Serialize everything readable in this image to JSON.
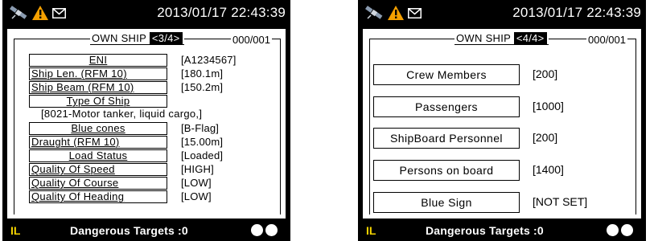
{
  "screens": [
    {
      "datetime": "2013/01/17 22:43:39",
      "title_prefix": "OWN SHIP ",
      "title_page": "<3/4>",
      "counter": "000/001",
      "fields": [
        {
          "label": "ENI",
          "value": "[A1234567]"
        },
        {
          "label": "Ship Len.  (RFM 10)",
          "value": "[180.1m]"
        },
        {
          "label": "Ship Beam (RFM 10)",
          "value": "[150.2m]"
        },
        {
          "label": "Type Of Ship",
          "value": ""
        },
        {
          "label": "",
          "value": "[8021-Motor tanker, liquid cargo,]"
        },
        {
          "label": "Blue  cones",
          "value": "[B-Flag]"
        },
        {
          "label": "Draught (RFM 10)",
          "value": "[15.00m]"
        },
        {
          "label": "Load Status",
          "value": "[Loaded]"
        },
        {
          "label": "Quality Of Speed",
          "value": "[HIGH]"
        },
        {
          "label": "Quality Of Course",
          "value": "[LOW]"
        },
        {
          "label": "Quality Of Heading",
          "value": "[LOW]"
        }
      ],
      "footer": {
        "indicator": "IL",
        "dangerous_targets": "Dangerous Targets :0"
      }
    },
    {
      "datetime": "2013/01/17 22:43:39",
      "title_prefix": "OWN SHIP ",
      "title_page": "<4/4>",
      "counter": "000/001",
      "fields": [
        {
          "label": "Crew Members",
          "value": "[200]"
        },
        {
          "label": "Passengers",
          "value": "[1000]"
        },
        {
          "label": "ShipBoard Personnel",
          "value": "[200]"
        },
        {
          "label": "Persons on board",
          "value": "[1400]"
        },
        {
          "label": "Blue Sign",
          "value": "[NOT SET]"
        }
      ],
      "footer": {
        "indicator": "IL",
        "dangerous_targets": "Dangerous Targets :0"
      }
    }
  ],
  "icons": {
    "satellite": "satellite-icon",
    "warning": "warning-icon",
    "mail": "mail-icon"
  },
  "colors": {
    "screen_bg": "#000000",
    "panel_bg": "#ffffff",
    "warning": "#f5a000",
    "indicator": "#f5d400",
    "satellite": "#8a9bb0"
  }
}
